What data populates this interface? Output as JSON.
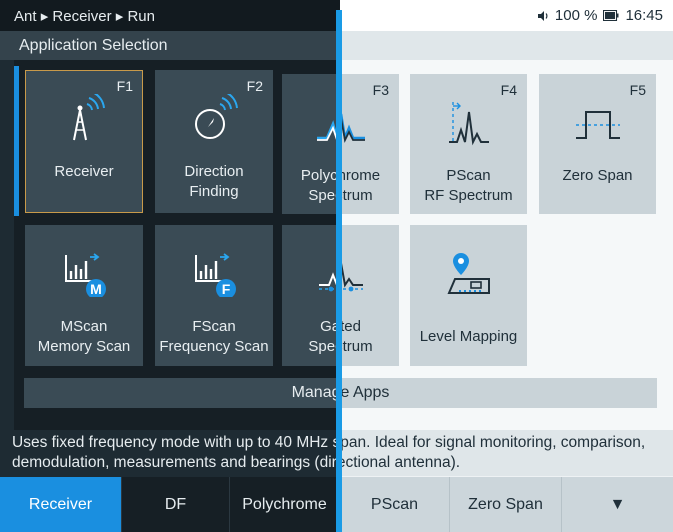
{
  "breadcrumb": [
    "Ant",
    "Receiver",
    "Run"
  ],
  "breadcrumb_separator": "▸",
  "status": {
    "battery": "100 %",
    "time": "16:45"
  },
  "title": "Application Selection",
  "apps_row1": [
    {
      "fkey": "F1",
      "label1": "Receiver",
      "label2": "",
      "icon": "receiver-antenna-icon"
    },
    {
      "fkey": "F2",
      "label1": "Direction",
      "label2": "Finding",
      "icon": "direction-finding-icon"
    },
    {
      "fkey": "F3",
      "label1": "Polychrome",
      "label2": "Spectrum",
      "icon": "polychrome-spectrum-icon"
    },
    {
      "fkey": "F4",
      "label1": "PScan",
      "label2": "RF Spectrum",
      "icon": "pscan-spectrum-icon"
    },
    {
      "fkey": "F5",
      "label1": "Zero Span",
      "label2": "",
      "icon": "zero-span-pulse-icon"
    }
  ],
  "apps_row2": [
    {
      "label1": "MScan",
      "label2": "Memory Scan",
      "icon": "mscan-memory-icon",
      "badge": "M"
    },
    {
      "label1": "FScan",
      "label2": "Frequency Scan",
      "icon": "fscan-frequency-icon",
      "badge": "F"
    },
    {
      "label1": "Gated",
      "label2": "Spectrum",
      "icon": "gated-spectrum-icon"
    },
    {
      "label1": "Level Mapping",
      "label2": "",
      "icon": "level-mapping-icon"
    }
  ],
  "manage_apps": "Manage Apps",
  "description": "Uses fixed frequency mode with up to 40 MHz span. Ideal for signal monitoring, comparison, demodulation, measurements and bearings (directional antenna).",
  "tabs": [
    "Receiver",
    "DF",
    "Polychrome",
    "PScan",
    "Zero Span"
  ],
  "more_tab": "▼",
  "colors": {
    "accent_blue": "#1a8fe0",
    "dark_bg": "#1e2b33",
    "light_bg": "#eef2f4",
    "active_outline": "#c89a4a"
  }
}
